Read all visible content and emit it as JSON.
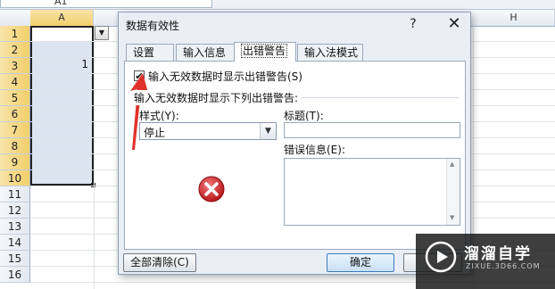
{
  "namebox": {
    "value": "A1"
  },
  "columns": [
    "A",
    "H"
  ],
  "rows": [
    "1",
    "2",
    "3",
    "4",
    "5",
    "6",
    "7",
    "8",
    "9",
    "10",
    "11",
    "12",
    "13",
    "14",
    "15",
    "16"
  ],
  "cells": {
    "A3": "1"
  },
  "dialog": {
    "title": "数据有效性",
    "help_label": "?",
    "close_label": "✕",
    "tabs": [
      {
        "label": "设置"
      },
      {
        "label": "输入信息"
      },
      {
        "label": "出错警告"
      },
      {
        "label": "输入法模式"
      }
    ],
    "active_tab": "出错警告",
    "show_error_checkbox": {
      "checked": true,
      "label": "输入无效数据时显示出错警告(S)"
    },
    "group_label": "输入无效数据时显示下列出错警告:",
    "style": {
      "label": "样式(Y):",
      "value": "停止"
    },
    "title_field": {
      "label": "标题(T):",
      "value": ""
    },
    "error_message": {
      "label": "错误信息(E):",
      "value": ""
    },
    "buttons": {
      "clear_all": "全部清除(C)",
      "ok": "确定",
      "cancel": ""
    }
  },
  "watermark": {
    "title": "溜溜自学",
    "subtitle": "ZIXUE.3D66.COM"
  },
  "colors": {
    "selection": "#dce4f0",
    "annotation_arrow": "#e0322b",
    "stop_icon": "#d9262a"
  }
}
